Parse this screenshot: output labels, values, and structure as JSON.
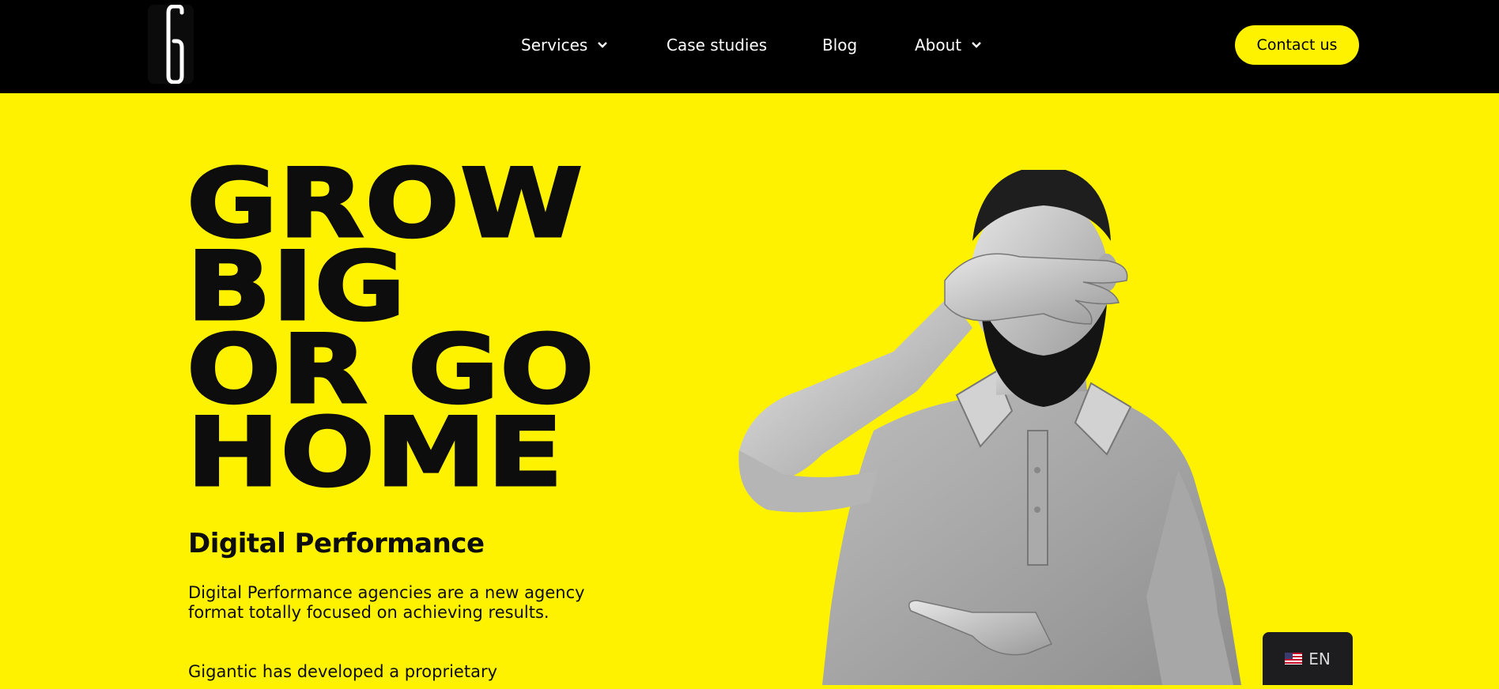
{
  "header": {
    "logo_name": "g-logo-icon",
    "nav": [
      {
        "label": "Services",
        "has_dropdown": true
      },
      {
        "label": "Case studies",
        "has_dropdown": false
      },
      {
        "label": "Blog",
        "has_dropdown": false
      },
      {
        "label": "About",
        "has_dropdown": true
      }
    ],
    "contact_label": "Contact us"
  },
  "hero": {
    "headline_lines": [
      "GROW",
      "BIG",
      "OR GO",
      "HOME"
    ],
    "subtitle": "Digital Performance",
    "paragraph_1": "Digital Performance agencies are a new agency format totally focused on achieving results.",
    "paragraph_2": "Gigantic has developed a proprietary"
  },
  "language": {
    "label": "EN",
    "flag_icon": "us-flag-icon"
  },
  "colors": {
    "accent": "#FFF200",
    "header_bg": "#000000",
    "text": "#0d0d0d",
    "lang_bg": "#1d1d1f"
  }
}
